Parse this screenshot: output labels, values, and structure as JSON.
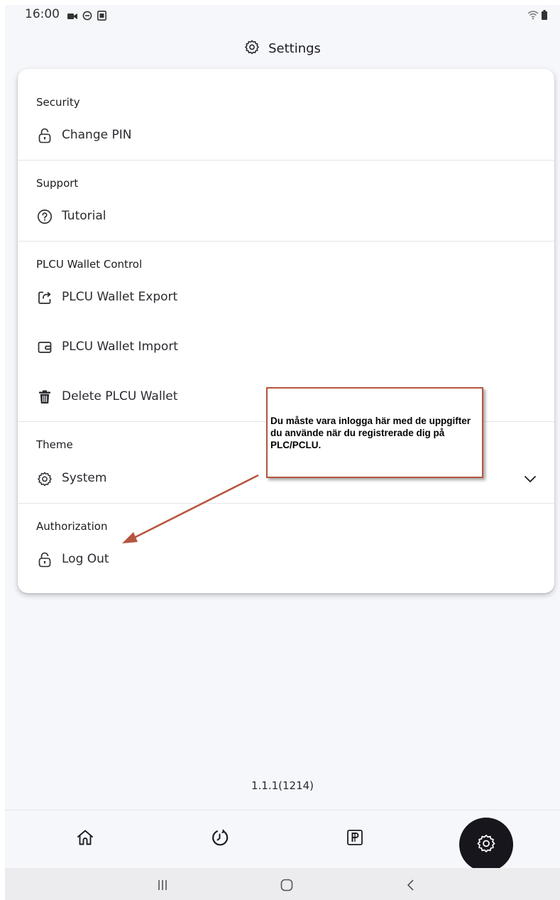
{
  "status_bar": {
    "time": "16:00",
    "left_icons": [
      "video-icon",
      "do-not-disturb-icon",
      "screenshot-icon"
    ],
    "right_icons": [
      "wifi-icon",
      "battery-icon"
    ]
  },
  "header": {
    "icon": "gear-icon",
    "title": "Settings"
  },
  "sections": {
    "security": {
      "title": "Security",
      "items": [
        {
          "label": "Change PIN",
          "icon": "lock-icon"
        }
      ]
    },
    "support": {
      "title": "Support",
      "items": [
        {
          "label": "Tutorial",
          "icon": "help-icon"
        }
      ]
    },
    "wallet": {
      "title": "PLCU Wallet Control",
      "items": [
        {
          "label": "PLCU Wallet Export",
          "icon": "export-icon"
        },
        {
          "label": "PLCU Wallet Import",
          "icon": "wallet-icon"
        },
        {
          "label": "Delete PLCU Wallet",
          "icon": "trash-icon"
        }
      ]
    },
    "theme": {
      "title": "Theme",
      "selected": "System",
      "icon": "gear-icon",
      "dropdown_icon": "chevron-down-icon"
    },
    "authorization": {
      "title": "Authorization",
      "items": [
        {
          "label": "Log Out",
          "icon": "lock-icon"
        }
      ]
    }
  },
  "annotation": {
    "text": "Du måste vara inlogga här med de uppgifter du använde när du registrerade dig på PLC/PCLU.",
    "border_color": "#b5553f",
    "arrow_color": "#b5553f"
  },
  "version": "1.1.1(1214)",
  "bottom_nav": {
    "items": [
      {
        "icon": "home-icon",
        "active": false
      },
      {
        "icon": "history-icon",
        "active": false
      },
      {
        "icon": "plcu-icon",
        "active": false
      },
      {
        "icon": "gear-icon",
        "active": true
      }
    ]
  },
  "system_nav": [
    "recent-apps-icon",
    "home-button-icon",
    "back-icon"
  ],
  "colors": {
    "background": "#f6f7fb",
    "card": "#ffffff",
    "active_nav": "#16161c",
    "text": "#1c1c22"
  }
}
